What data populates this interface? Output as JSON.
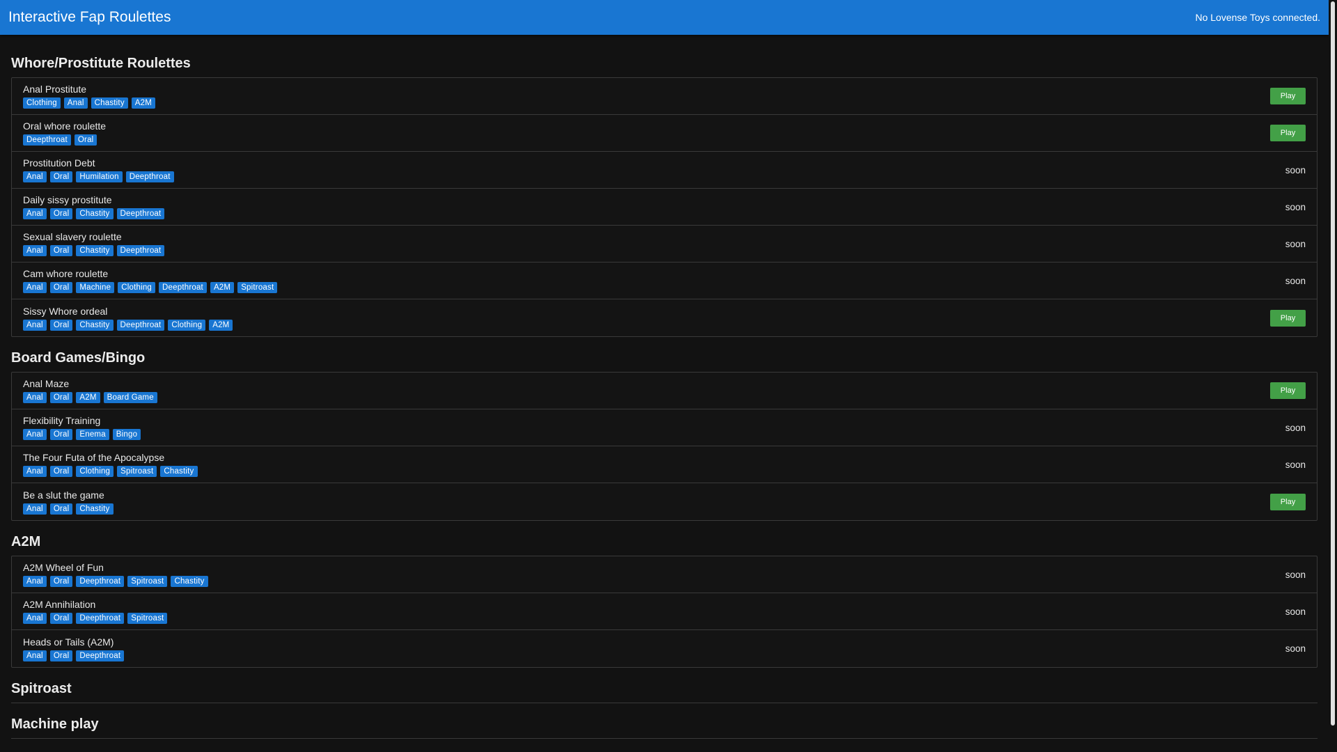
{
  "header": {
    "title": "Interactive Fap Roulettes",
    "status": "No Lovense Toys connected."
  },
  "sections": [
    {
      "title": "Whore/Prostitute Roulettes",
      "items": [
        {
          "name": "Anal Prostitute",
          "tags": [
            "Clothing",
            "Anal",
            "Chastity",
            "A2M"
          ],
          "action": "Play"
        },
        {
          "name": "Oral whore roulette",
          "tags": [
            "Deepthroat",
            "Oral"
          ],
          "action": "Play"
        },
        {
          "name": "Prostitution Debt",
          "tags": [
            "Anal",
            "Oral",
            "Humilation",
            "Deepthroat"
          ],
          "action": "soon"
        },
        {
          "name": "Daily sissy prostitute",
          "tags": [
            "Anal",
            "Oral",
            "Chastity",
            "Deepthroat"
          ],
          "action": "soon"
        },
        {
          "name": "Sexual slavery roulette",
          "tags": [
            "Anal",
            "Oral",
            "Chastity",
            "Deepthroat"
          ],
          "action": "soon"
        },
        {
          "name": "Cam whore roulette",
          "tags": [
            "Anal",
            "Oral",
            "Machine",
            "Clothing",
            "Deepthroat",
            "A2M",
            "Spitroast"
          ],
          "action": "soon"
        },
        {
          "name": "Sissy Whore ordeal",
          "tags": [
            "Anal",
            "Oral",
            "Chastity",
            "Deepthroat",
            "Clothing",
            "A2M"
          ],
          "action": "Play"
        }
      ]
    },
    {
      "title": "Board Games/Bingo",
      "items": [
        {
          "name": "Anal Maze",
          "tags": [
            "Anal",
            "Oral",
            "A2M",
            "Board Game"
          ],
          "action": "Play"
        },
        {
          "name": "Flexibility Training",
          "tags": [
            "Anal",
            "Oral",
            "Enema",
            "Bingo"
          ],
          "action": "soon"
        },
        {
          "name": "The Four Futa of the Apocalypse",
          "tags": [
            "Anal",
            "Oral",
            "Clothing",
            "Spitroast",
            "Chastity"
          ],
          "action": "soon"
        },
        {
          "name": "Be a slut the game",
          "tags": [
            "Anal",
            "Oral",
            "Chastity"
          ],
          "action": "Play"
        }
      ]
    },
    {
      "title": "A2M",
      "items": [
        {
          "name": "A2M Wheel of Fun",
          "tags": [
            "Anal",
            "Oral",
            "Deepthroat",
            "Spitroast",
            "Chastity"
          ],
          "action": "soon"
        },
        {
          "name": "A2M Annihilation",
          "tags": [
            "Anal",
            "Oral",
            "Deepthroat",
            "Spitroast"
          ],
          "action": "soon"
        },
        {
          "name": "Heads or Tails (A2M)",
          "tags": [
            "Anal",
            "Oral",
            "Deepthroat"
          ],
          "action": "soon"
        }
      ]
    },
    {
      "title": "Spitroast",
      "items": []
    },
    {
      "title": "Machine play",
      "items": []
    }
  ],
  "colors": {
    "header_bg": "#1976d2",
    "tag_bg": "#1976d2",
    "play_bg": "#43a047",
    "page_bg": "#121212"
  }
}
